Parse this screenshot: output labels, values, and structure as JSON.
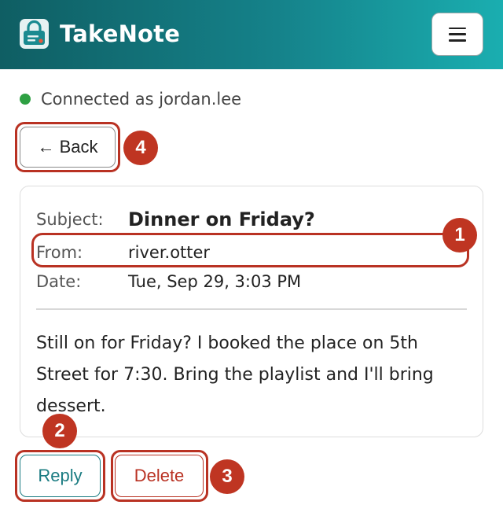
{
  "header": {
    "app_title": "TakeNote",
    "logo_icon": "lock-note-icon",
    "menu_icon": "hamburger-menu-icon",
    "gradient": [
      "#0f5e63",
      "#1aaeb0"
    ]
  },
  "status": {
    "text": "Connected as jordan.lee",
    "indicator_color": "#2ea043"
  },
  "nav": {
    "back_label": "← Back"
  },
  "message": {
    "subject_label": "Subject:",
    "subject": "Dinner on Friday?",
    "from_label": "From:",
    "from": "river.otter",
    "date_label": "Date:",
    "date": "Tue, Sep 29, 3:03 PM",
    "body": "Still on for Friday? I booked the place on 5th Street for 7:30. Bring the playlist and I'll bring dessert."
  },
  "actions": {
    "reply_label": "Reply",
    "delete_label": "Delete"
  },
  "annotations": {
    "badge_1": "1",
    "badge_2": "2",
    "badge_3": "3",
    "badge_4": "4",
    "color": "#bf3522"
  }
}
